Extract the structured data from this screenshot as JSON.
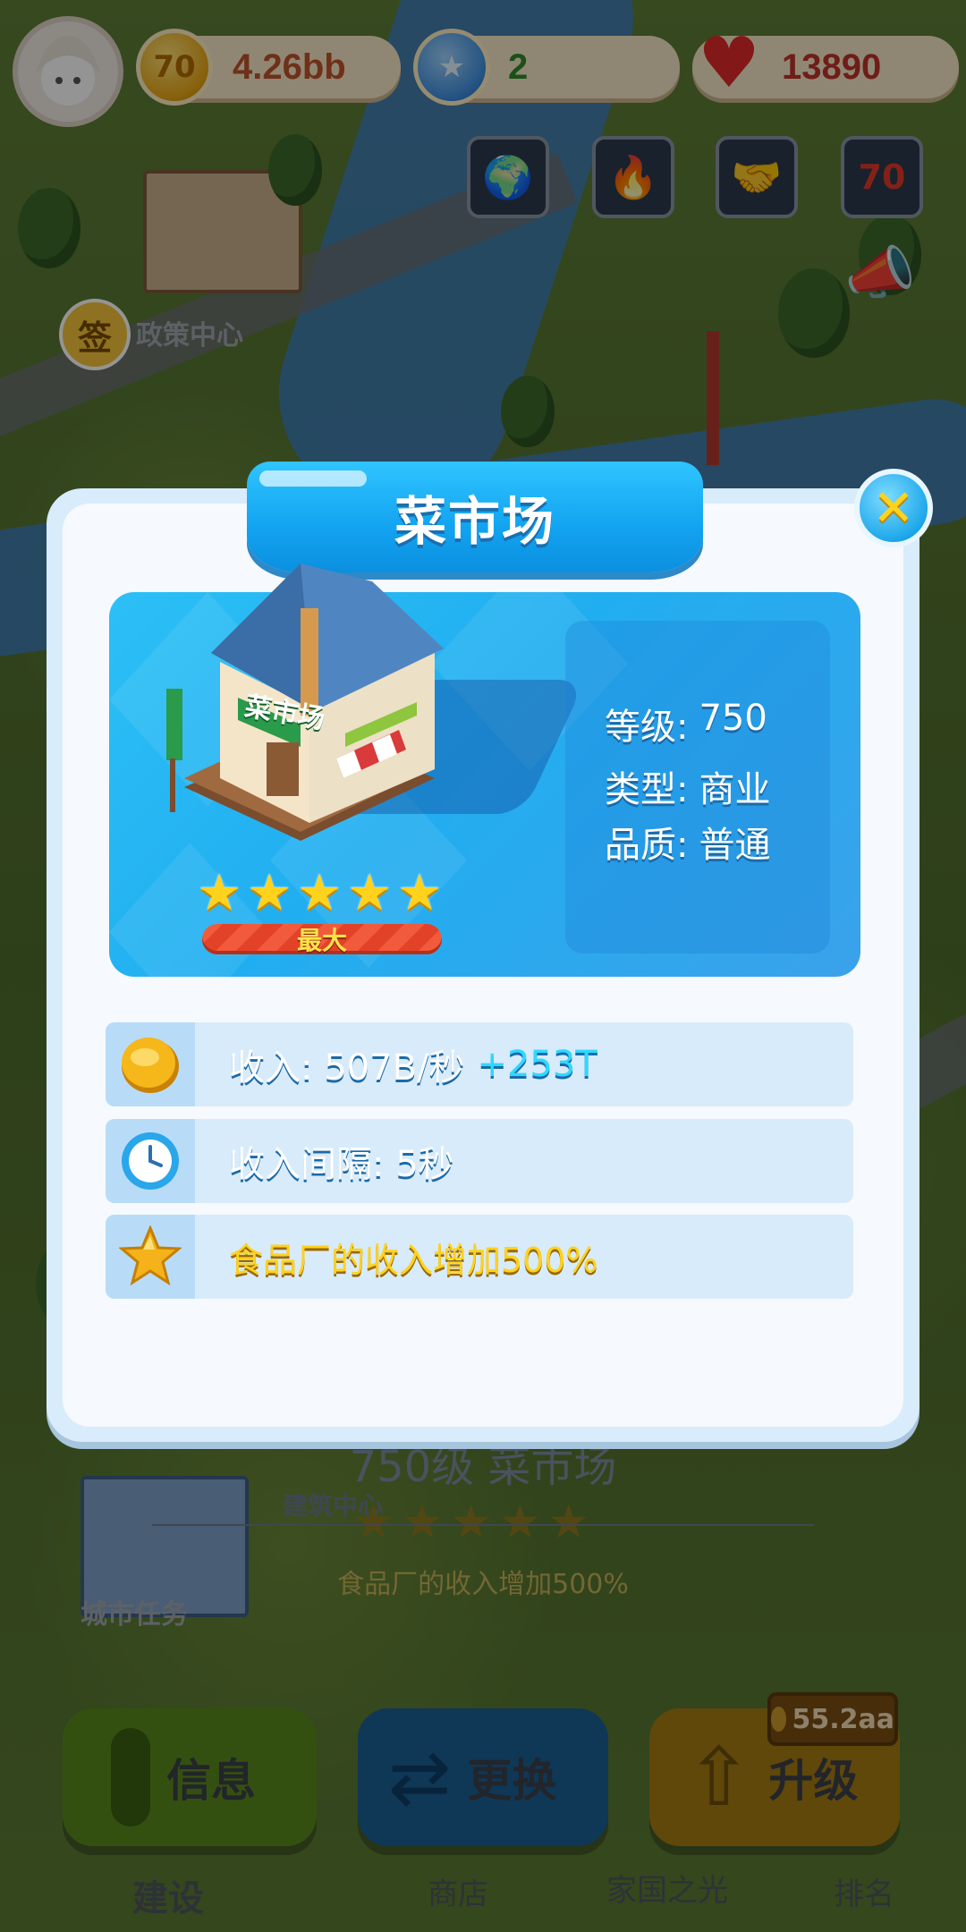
{
  "hud": {
    "coins": "4.26bb",
    "stars": "2",
    "hearts": "13890",
    "coin_glyph": "70"
  },
  "world": {
    "sign_label": "签",
    "policy_center": "政策中心",
    "city_tasks": "城市任务",
    "building_center": "建筑中心"
  },
  "modal": {
    "title": "菜市场",
    "close_glyph": "✕",
    "building_sign": "菜市场",
    "stats": {
      "level_label": "等级:",
      "level_value": "750",
      "type_label": "类型:",
      "type_value": "商业",
      "quality_label": "品质:",
      "quality_value": "普通"
    },
    "star_count": 5,
    "max_label": "最大",
    "rows": [
      {
        "text": "收入: 507B/秒",
        "bonus": "+253T"
      },
      {
        "text": "收入间隔: 5秒",
        "bonus": ""
      },
      {
        "text": "食品厂的收入增加500%",
        "bonus": ""
      }
    ]
  },
  "background_panel": {
    "title": "750级 菜市场",
    "effect": "食品厂的收入增加500%"
  },
  "actions": {
    "info": "信息",
    "swap": "更换",
    "upgrade": "升级",
    "upgrade_cost": "55.2aa"
  },
  "nav": [
    "建设",
    "商店",
    "家国之光",
    "排名"
  ],
  "colors": {
    "accent_blue": "#12a3f0",
    "star_gold": "#ffd21e",
    "bonus_cyan": "#2fd8ff"
  }
}
